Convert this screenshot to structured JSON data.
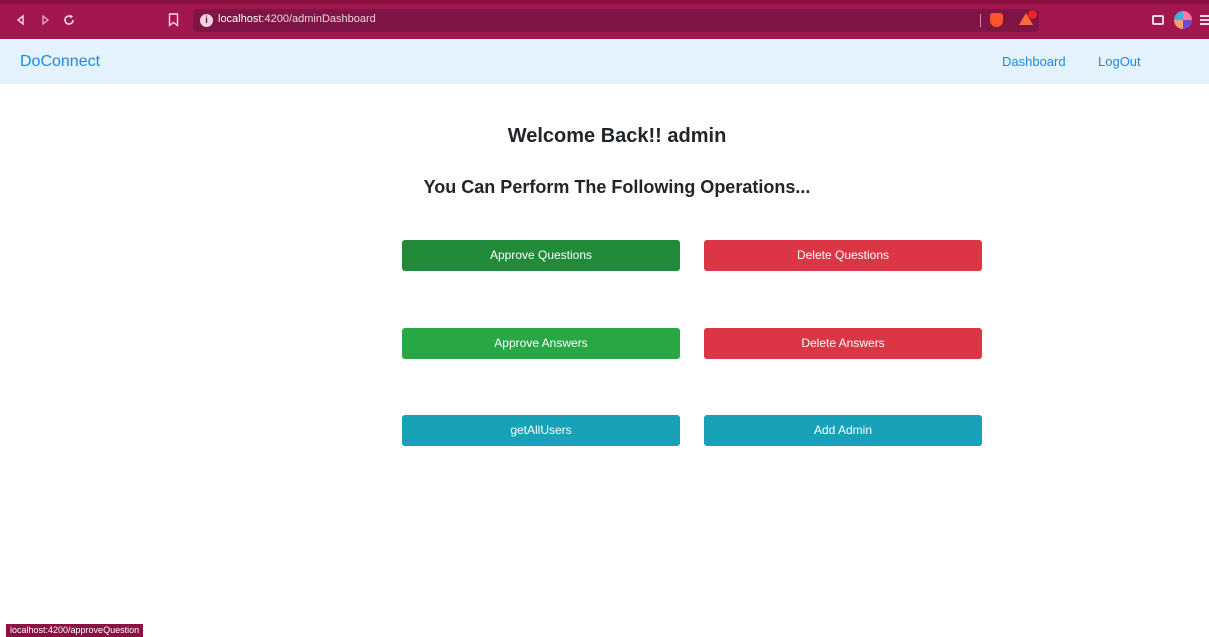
{
  "browser": {
    "url_host": "localhost",
    "url_path": ":4200/adminDashboard",
    "status_url": "localhost:4200/approveQuestion"
  },
  "navbar": {
    "brand": "DoConnect",
    "links": [
      "Dashboard",
      "LogOut"
    ]
  },
  "main": {
    "welcome": "Welcome Back!! admin",
    "subtitle": "You Can Perform The Following Operations...",
    "buttons": {
      "approve_questions": "Approve Questions",
      "delete_questions": "Delete Questions",
      "approve_answers": "Approve Answers",
      "delete_answers": "Delete Answers",
      "get_all_users": "getAllUsers",
      "add_admin": "Add Admin"
    }
  },
  "colors": {
    "browser_chrome": "#a3174f",
    "navbar_bg": "#e3f2fd",
    "link": "#1e88e5",
    "success_dark": "#228b3a",
    "success": "#28a745",
    "danger": "#dc3545",
    "info": "#17a2b8"
  },
  "icons": [
    "back-icon",
    "forward-icon",
    "reload-icon",
    "bookmark-icon",
    "info-icon",
    "brave-shield-icon",
    "brave-rewards-icon",
    "wallet-icon",
    "profile-icon",
    "menu-icon"
  ]
}
